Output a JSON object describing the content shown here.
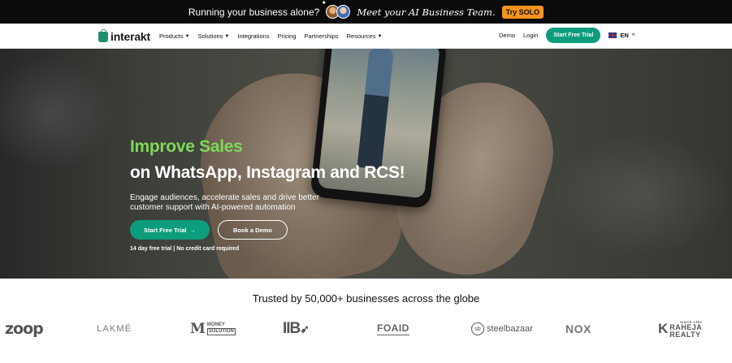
{
  "promo": {
    "text": "Running your business alone?",
    "tagline": "Meet your AI Business Team.",
    "cta": "Try SOLO"
  },
  "nav": {
    "logo": "interakt",
    "links": [
      {
        "label": "Products",
        "has_dropdown": true
      },
      {
        "label": "Solutions",
        "has_dropdown": true
      },
      {
        "label": "Integrations",
        "has_dropdown": false
      },
      {
        "label": "Pricing",
        "has_dropdown": false
      },
      {
        "label": "Partnerships",
        "has_dropdown": false
      },
      {
        "label": "Resources",
        "has_dropdown": true
      }
    ],
    "demo": "Demo",
    "login": "Login",
    "trial": "Start Free Trial",
    "lang": "EN"
  },
  "hero": {
    "headline_accent": "Improve Sales",
    "headline_main": "on WhatsApp, Instagram and RCS!",
    "subtext": "Engage audiences, accelerate sales and drive better customer support with AI-powered automation",
    "trial_btn": "Start Free Trial",
    "demo_btn": "Book a Demo",
    "note": "14 day free trial | No credit card required"
  },
  "trusted": {
    "heading": "Trusted by 50,000+ businesses across the globe",
    "logos": {
      "zoop": "zoop",
      "lakme": "LAKMÉ",
      "money_m": "M",
      "money_top": "MONEY",
      "money_bottom": "SOLUTION",
      "iib": "IIB",
      "foaid": "FOAID",
      "steel_mark": "sb",
      "steel": "steelbazaar",
      "nox": "NOX",
      "raheja_k": "K",
      "raheja_since": "SINCE 1956",
      "raheja_top": "RAHEJA",
      "raheja_bottom": "REALTY"
    }
  },
  "colors": {
    "accent_green": "#0d9c7c",
    "headline_green": "#7ed957",
    "promo_orange": "#f7931e"
  }
}
